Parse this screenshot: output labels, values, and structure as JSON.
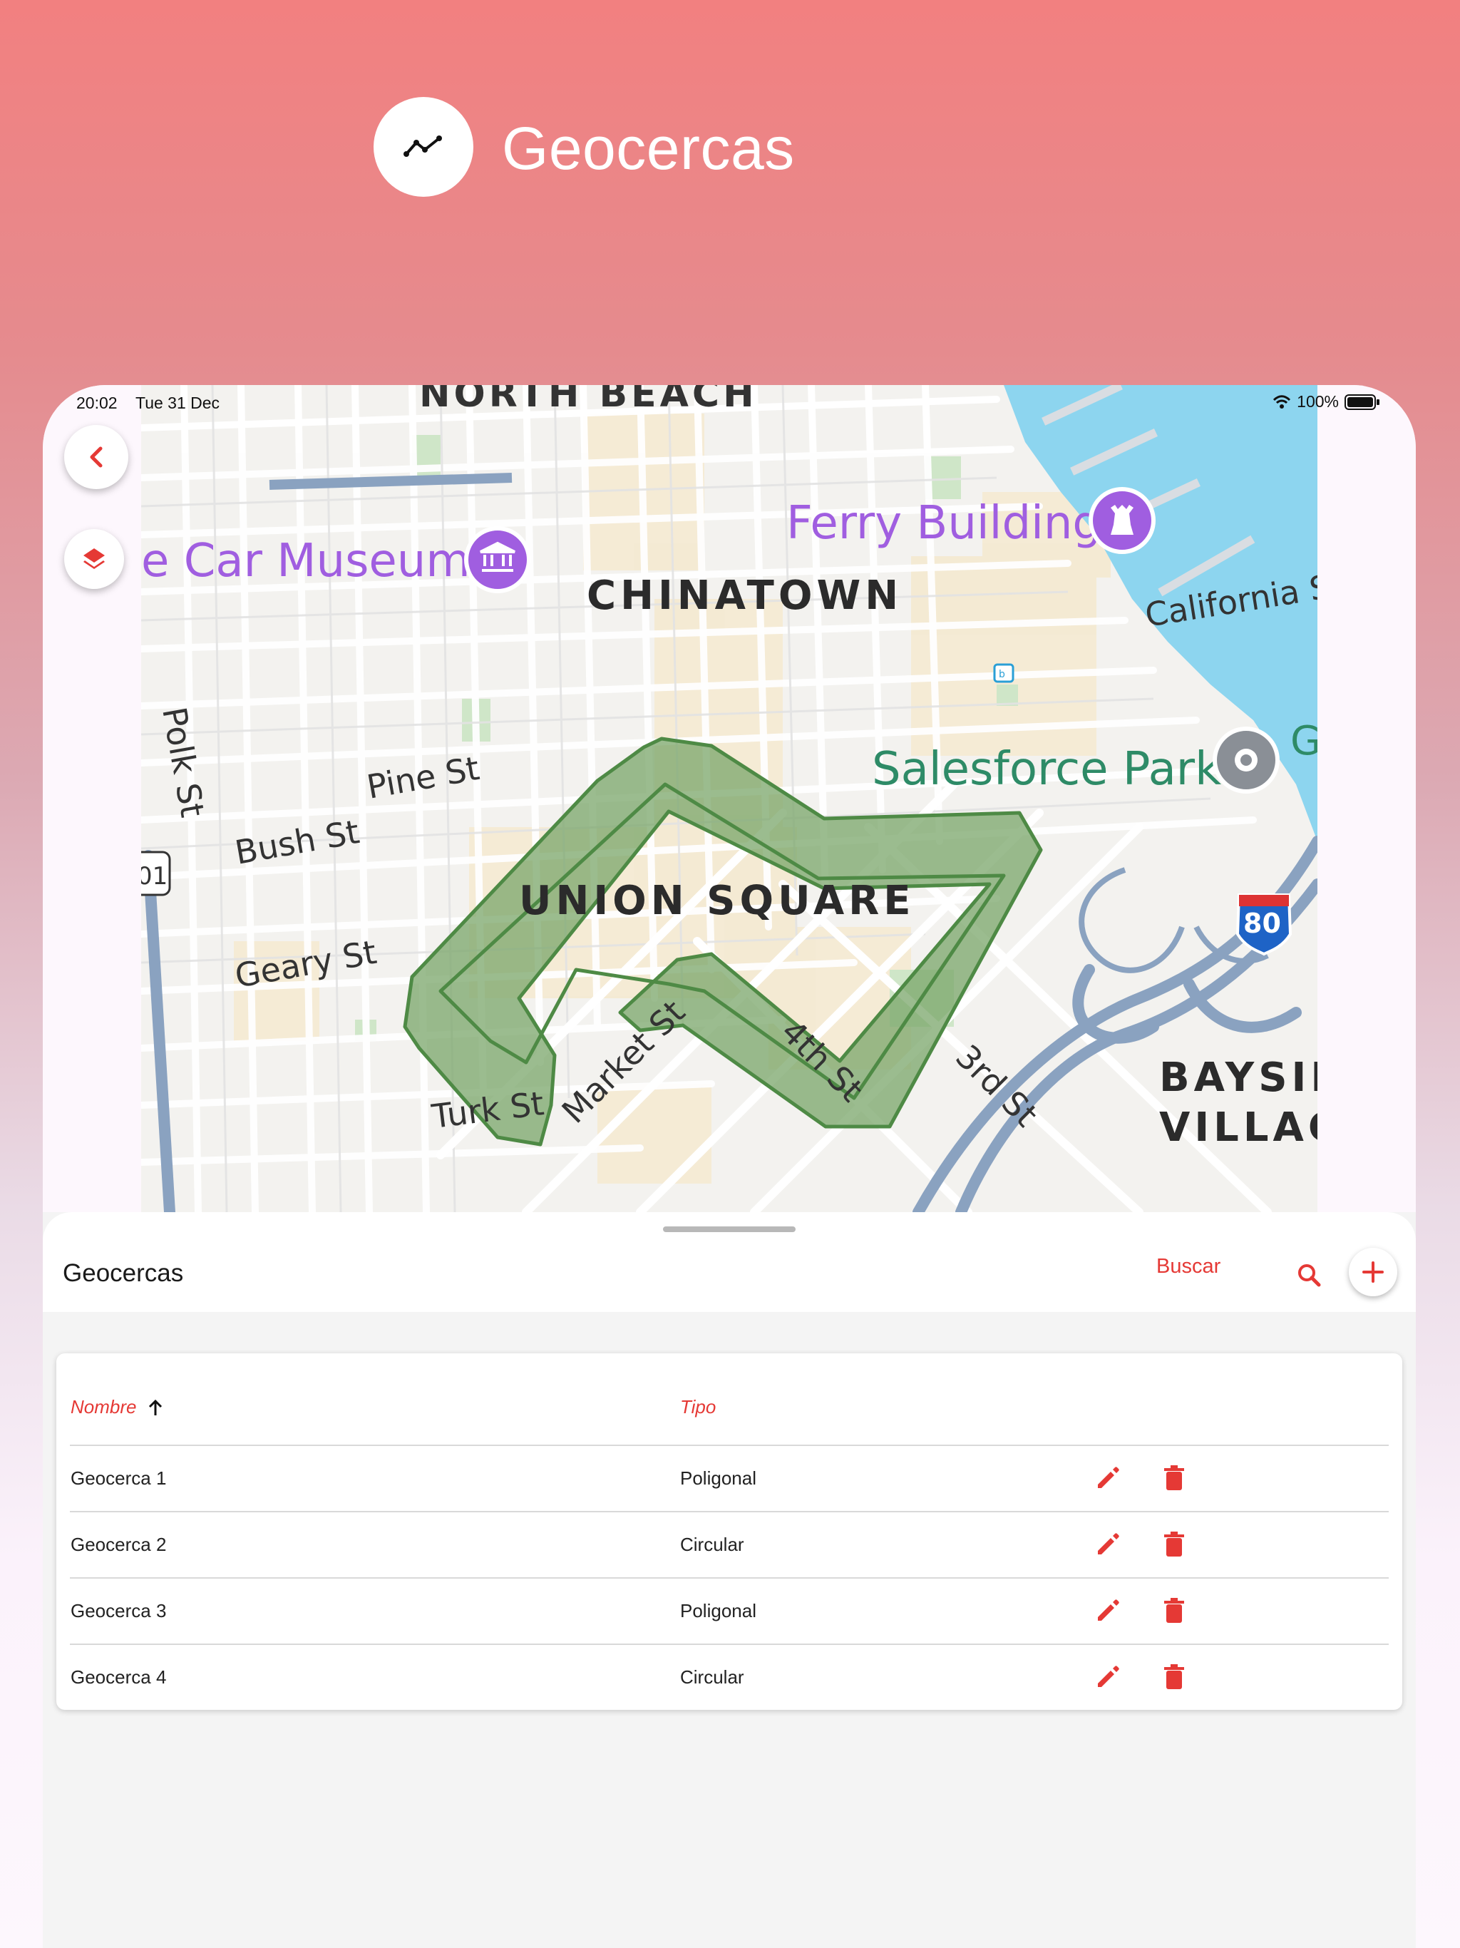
{
  "header": {
    "title": "Geocercas",
    "icon": "trend-line-icon"
  },
  "status_bar": {
    "time": "20:02",
    "date": "Tue 31 Dec",
    "battery": "100%"
  },
  "map": {
    "labels": {
      "north_beach": "NORTH BEACH",
      "chinatown": "CHINATOWN",
      "union_square": "UNION SQUARE",
      "bayside_1": "BAYSID",
      "bayside_2": "VILLAG",
      "car_museum": "e Car Museum",
      "ferry_building": "Ferry Building",
      "salesforce_park": "Salesforce Park",
      "california_st": "California St",
      "pine_st": "Pine St",
      "bush_st": "Bush St",
      "geary_st": "Geary St",
      "polk_st": "Polk St",
      "turk_st": "Turk St",
      "market_st": "Market St",
      "fourth_st": "4th St",
      "third_st": "3rd St",
      "interstate": "80",
      "us_route": "01",
      "corner_g": "G"
    },
    "colors": {
      "geofence_fill": "#7aa66a",
      "geofence_stroke": "#4e8a45",
      "water": "#8dd5ef",
      "poi_purple": "#a05ee0",
      "park_green": "#2e8b67",
      "street_main": "#ffffff",
      "freeway": "#8aa2c0"
    }
  },
  "map_controls": {
    "back_icon": "chevron-left-icon",
    "layers_icon": "layers-icon"
  },
  "sheet": {
    "title": "Geocercas",
    "search_label": "Buscar",
    "search_icon": "search-icon",
    "add_icon": "plus-icon"
  },
  "table": {
    "columns": {
      "name": "Nombre",
      "type": "Tipo"
    },
    "sort_icon": "arrow-up-icon",
    "rows": [
      {
        "name": "Geocerca 1",
        "type": "Poligonal"
      },
      {
        "name": "Geocerca 2",
        "type": "Circular"
      },
      {
        "name": "Geocerca 3",
        "type": "Poligonal"
      },
      {
        "name": "Geocerca 4",
        "type": "Circular"
      }
    ]
  },
  "colors": {
    "accent": "#e53935",
    "header_gradient_top": "#f28080"
  }
}
